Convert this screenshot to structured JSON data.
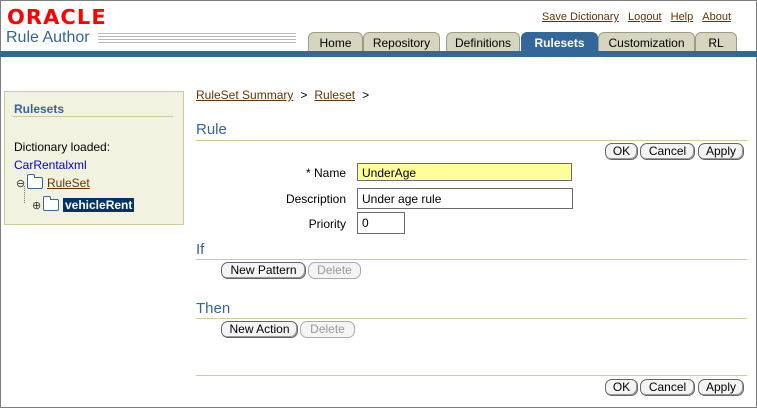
{
  "header": {
    "logo": "ORACLE",
    "app_title": "Rule Author",
    "links": [
      "Save Dictionary",
      "Logout",
      "Help",
      "About"
    ]
  },
  "tabs": [
    {
      "label": "Home",
      "active": false
    },
    {
      "label": "Repository",
      "active": false
    },
    {
      "label": "Definitions",
      "active": false
    },
    {
      "label": "Rulesets",
      "active": true
    },
    {
      "label": "Customization",
      "active": false
    },
    {
      "label": "RL",
      "active": false
    }
  ],
  "sidebar": {
    "heading": "Rulesets",
    "dictionary_label": "Dictionary loaded:",
    "dictionary_name": "CarRentalxml",
    "tree": {
      "root": "RuleSet",
      "root_expand_symbol": "⊖",
      "child": "vehicleRent",
      "child_expand_symbol": "⊕"
    }
  },
  "breadcrumb": {
    "items": [
      "RuleSet Summary",
      "Ruleset"
    ],
    "separator": ">"
  },
  "rule": {
    "heading": "Rule",
    "ok": "OK",
    "cancel": "Cancel",
    "apply": "Apply",
    "name_label": "* Name",
    "name_value": "UnderAge",
    "description_label": "Description",
    "description_value": "Under age rule",
    "priority_label": "Priority",
    "priority_value": "0"
  },
  "if_section": {
    "heading": "If",
    "new_button": "New Pattern",
    "delete_button": "Delete"
  },
  "then_section": {
    "heading": "Then",
    "new_button": "New Action",
    "delete_button": "Delete"
  },
  "footer_buttons": {
    "ok": "OK",
    "cancel": "Cancel",
    "apply": "Apply"
  },
  "colors": {
    "accent": "#336699",
    "brand": "#ff0000",
    "link": "#663300",
    "required_bg": "#ffff99"
  }
}
